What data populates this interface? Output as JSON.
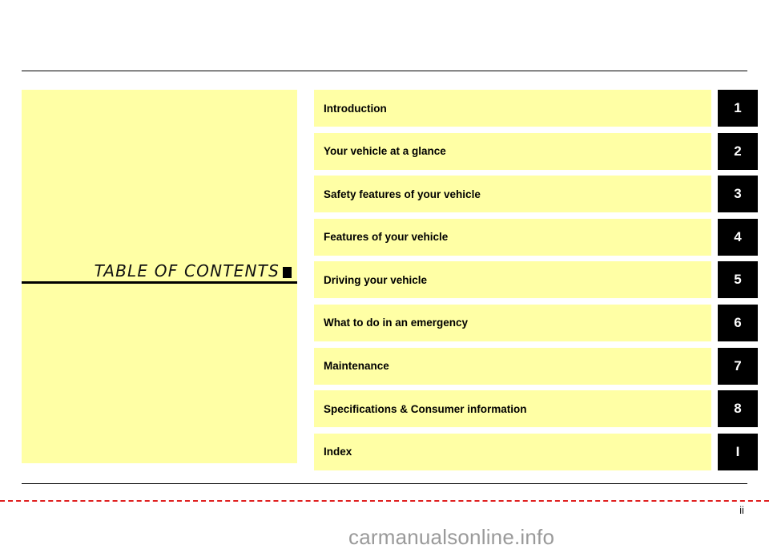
{
  "document": {
    "title": "TABLE  OF  CONTENTS",
    "page_number": "ii",
    "watermark": "carmanualsonline.info"
  },
  "colors": {
    "highlight": "#ffffa5",
    "tab": "#000000",
    "tab_text": "#ffffff",
    "cut_line": "#e02020"
  },
  "contents": [
    {
      "label": "Introduction",
      "tab": "1"
    },
    {
      "label": "Your vehicle at a glance",
      "tab": "2"
    },
    {
      "label": "Safety features of your vehicle",
      "tab": "3"
    },
    {
      "label": "Features of your vehicle",
      "tab": "4"
    },
    {
      "label": "Driving your vehicle",
      "tab": "5"
    },
    {
      "label": "What to do in an emergency",
      "tab": "6"
    },
    {
      "label": "Maintenance",
      "tab": "7"
    },
    {
      "label": "Specifications & Consumer information",
      "tab": "8"
    },
    {
      "label": "Index",
      "tab": "I"
    }
  ]
}
